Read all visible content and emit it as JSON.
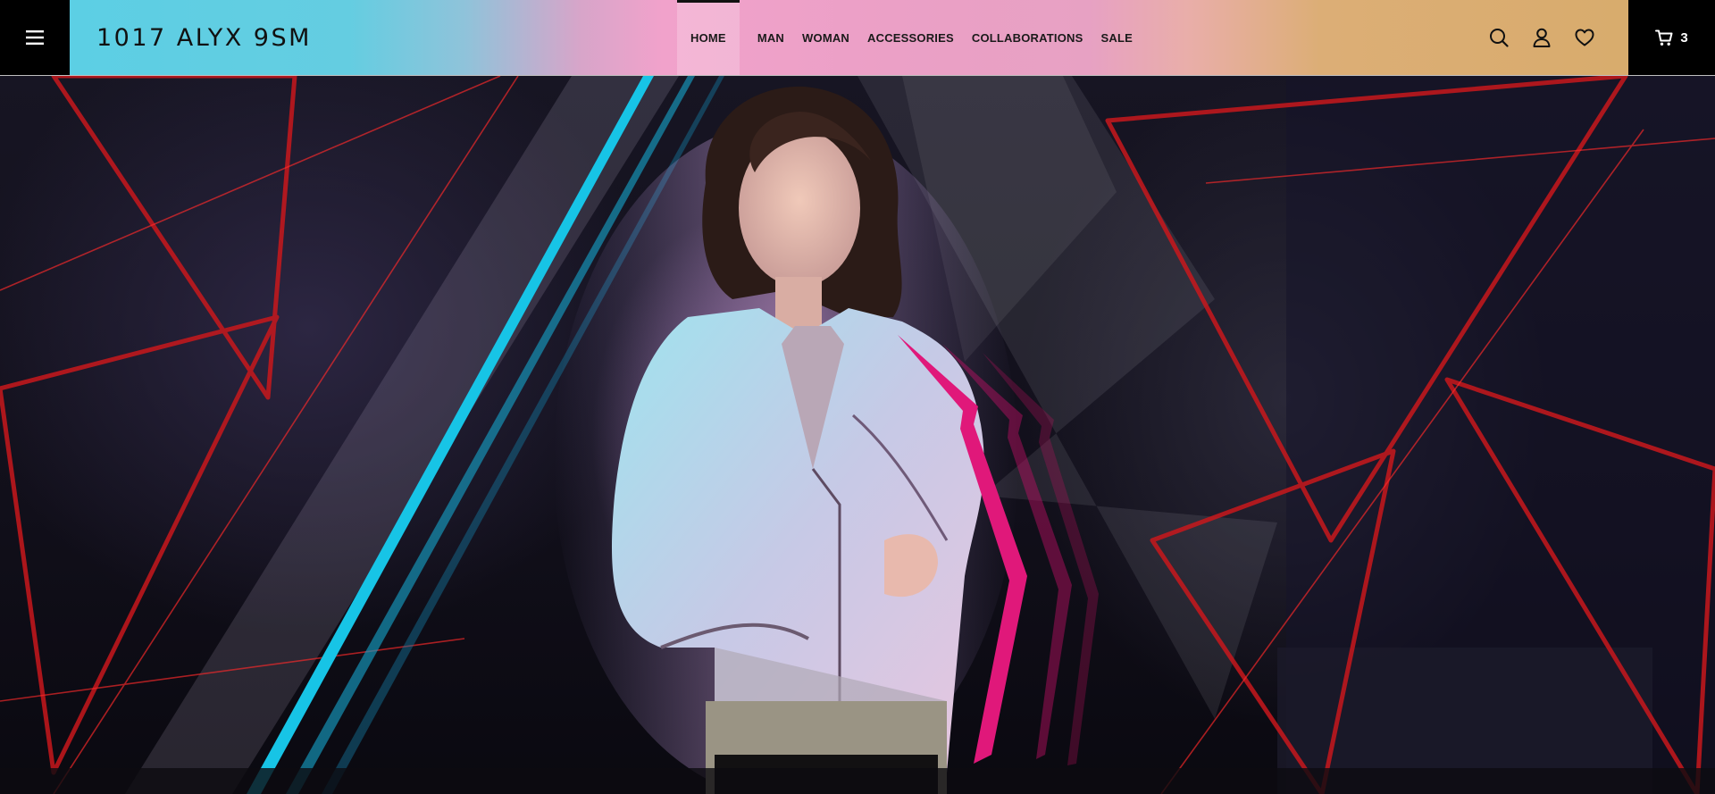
{
  "header": {
    "logo": "1017 ALYX 9SM",
    "nav": [
      {
        "label": "HOME",
        "active": true
      },
      {
        "label": "MAN",
        "active": false
      },
      {
        "label": "WOMAN",
        "active": false
      },
      {
        "label": "ACCESSORIES",
        "active": false
      },
      {
        "label": "COLLABORATIONS",
        "active": false
      },
      {
        "label": "SALE",
        "active": false
      }
    ],
    "cart_count": "3",
    "icons": {
      "menu": "hamburger-menu-icon",
      "search": "search-icon",
      "account": "user-icon",
      "wishlist": "heart-icon",
      "cart": "cart-icon"
    }
  },
  "colors": {
    "gradient_start": "#5ccfe4",
    "gradient_mid": "#f1a2cb",
    "gradient_end": "#d7ab6a",
    "accent_cyan": "#17c4e6",
    "accent_magenta": "#e0187a",
    "accent_red": "#c8181c"
  }
}
